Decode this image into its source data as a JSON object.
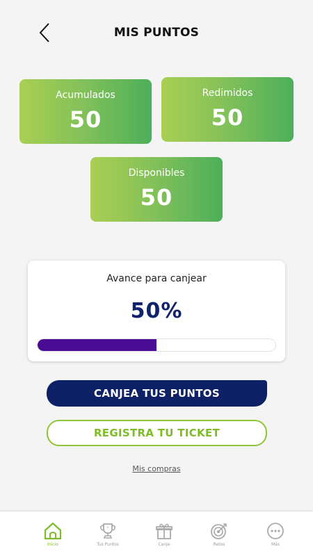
{
  "header": {
    "title": "MIS PUNTOS"
  },
  "cards": [
    {
      "label": "Acumulados",
      "value": "50"
    },
    {
      "label": "Redimidos",
      "value": "50"
    },
    {
      "label": "Disponibles",
      "value": "50"
    }
  ],
  "progress": {
    "title": "Avance para canjear",
    "percent_text": "50%",
    "percent_value": 50
  },
  "buttons": {
    "redeem": "CANJEA TUS PUNTOS",
    "register": "REGISTRA TU TICKET"
  },
  "link": "Mis compras",
  "nav": [
    {
      "label": "Inicio",
      "icon": "home-icon",
      "active": true
    },
    {
      "label": "Tus Puntos",
      "icon": "trophy-icon",
      "active": false
    },
    {
      "label": "Canje",
      "icon": "gift-icon",
      "active": false
    },
    {
      "label": "Retos",
      "icon": "target-icon",
      "active": false
    },
    {
      "label": "Más",
      "icon": "more-icon",
      "active": false
    }
  ],
  "colors": {
    "accent_green": "#7dbb27",
    "navy": "#0f2166",
    "progress_purple": "#4b0c95"
  }
}
